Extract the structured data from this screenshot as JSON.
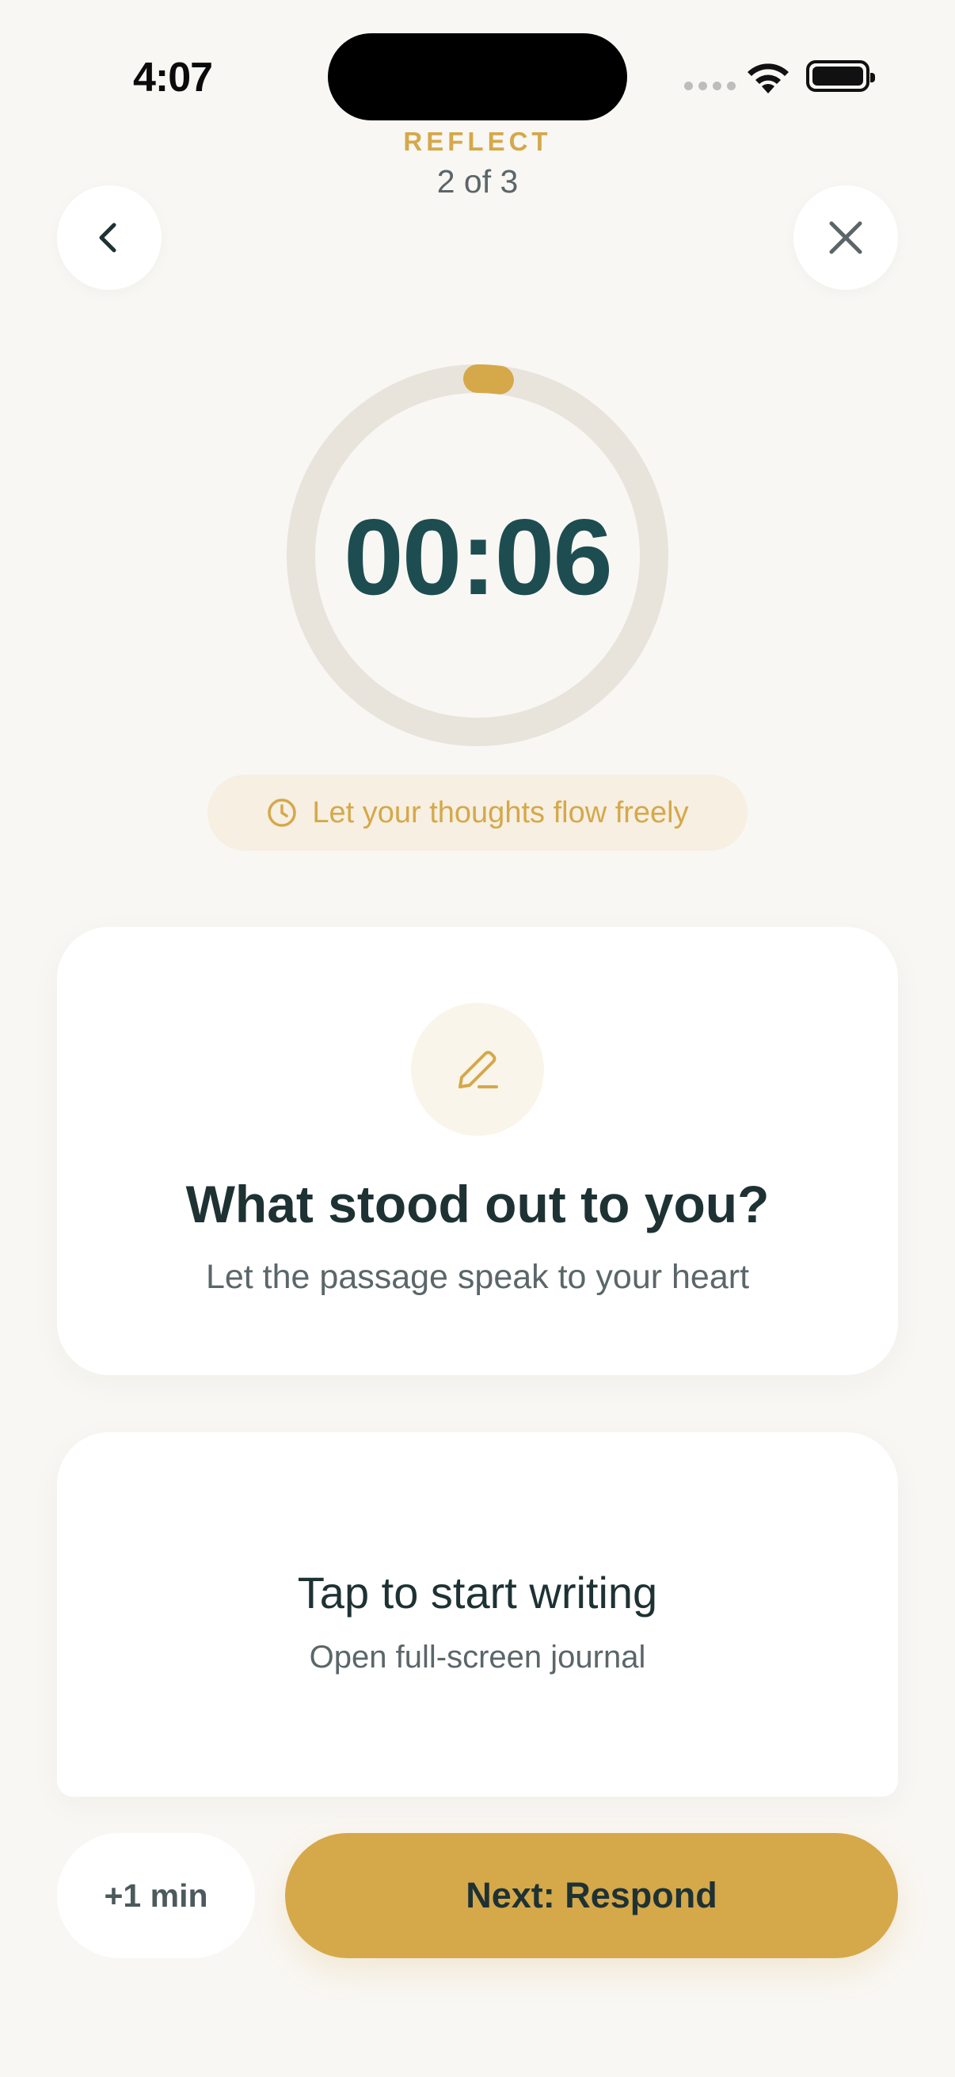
{
  "status_bar": {
    "time": "4:07"
  },
  "header": {
    "step_label": "REFLECT",
    "step_count": "2 of 3",
    "back_icon": "chevron-left-icon",
    "close_icon": "close-icon"
  },
  "timer": {
    "display": "00:06",
    "progress_fraction": 0.02
  },
  "hint": {
    "icon": "clock-icon",
    "text": "Let your thoughts flow freely"
  },
  "prompt": {
    "icon": "pencil-icon",
    "title": "What stood out to you?",
    "subtitle": "Let the passage speak to your heart"
  },
  "journal": {
    "title": "Tap to start writing",
    "subtitle": "Open full-screen journal"
  },
  "actions": {
    "add_time_label": "+1 min",
    "next_label": "Next: Respond"
  },
  "colors": {
    "background": "#f9f7f3",
    "accent": "#d5a84a",
    "timer_text": "#1d4d51",
    "ring_track": "#e8e3db",
    "text_primary": "#1e3234",
    "text_secondary": "#5b6669"
  }
}
